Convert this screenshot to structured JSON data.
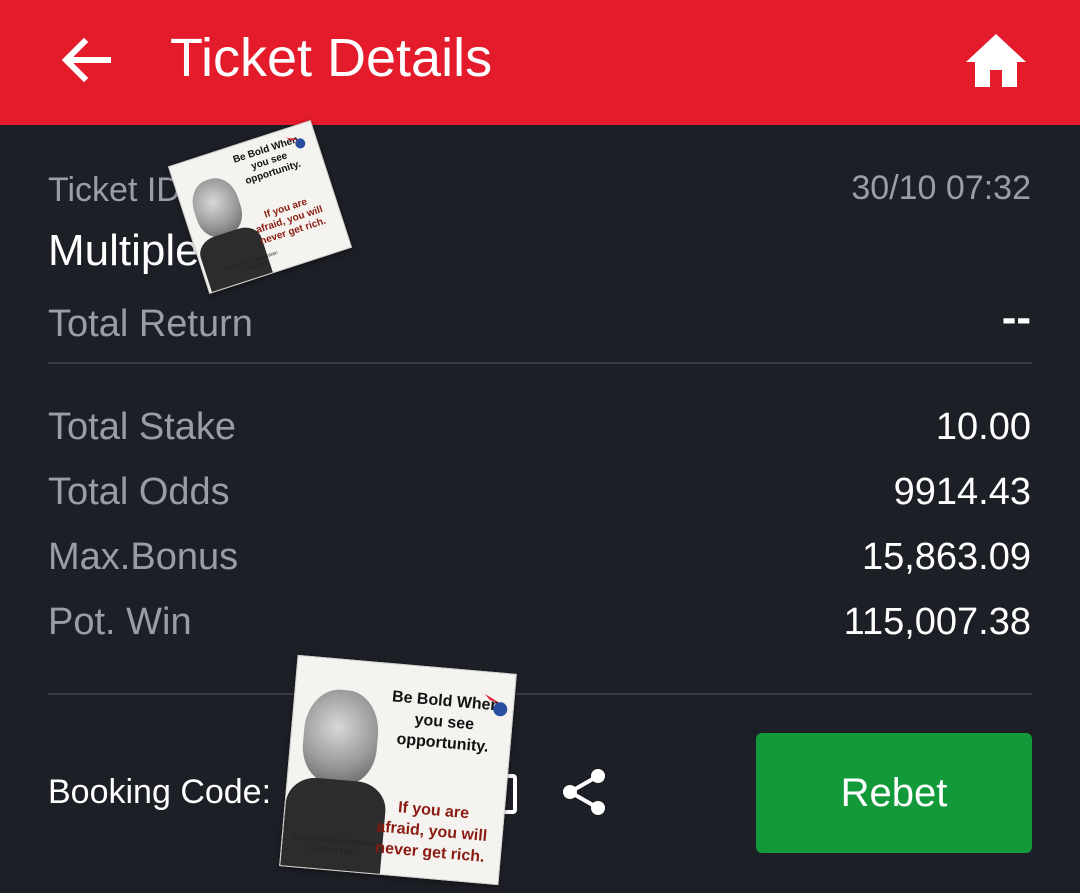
{
  "header": {
    "title": "Ticket Details",
    "back_icon": "arrow-left-icon",
    "home_icon": "home-icon",
    "background_color": "#e31b2b"
  },
  "ticket": {
    "id_label": "Ticket ID",
    "date": "30/10 07:32",
    "bet_type": "Multiple",
    "total_return_label": "Total Return",
    "total_return_value": "--"
  },
  "summary": [
    {
      "label": "Total Stake",
      "value": "10.00"
    },
    {
      "label": "Total Odds",
      "value": "9914.43"
    },
    {
      "label": "Max.Bonus",
      "value": "15,863.09"
    },
    {
      "label": "Pot. Win",
      "value": "115,007.38"
    }
  ],
  "footer": {
    "booking_code_label": "Booking Code:",
    "copy_icon": "copy-icon",
    "share_icon": "share-icon",
    "rebet_label": "Rebet",
    "rebet_color": "#12993a"
  },
  "sticker": {
    "quote_line1": "Be Bold When you see opportunity.",
    "quote_line2": "If you are afraid, you will never get rich.",
    "caption": "Robert Kuok. Malaysian Richest Man"
  }
}
